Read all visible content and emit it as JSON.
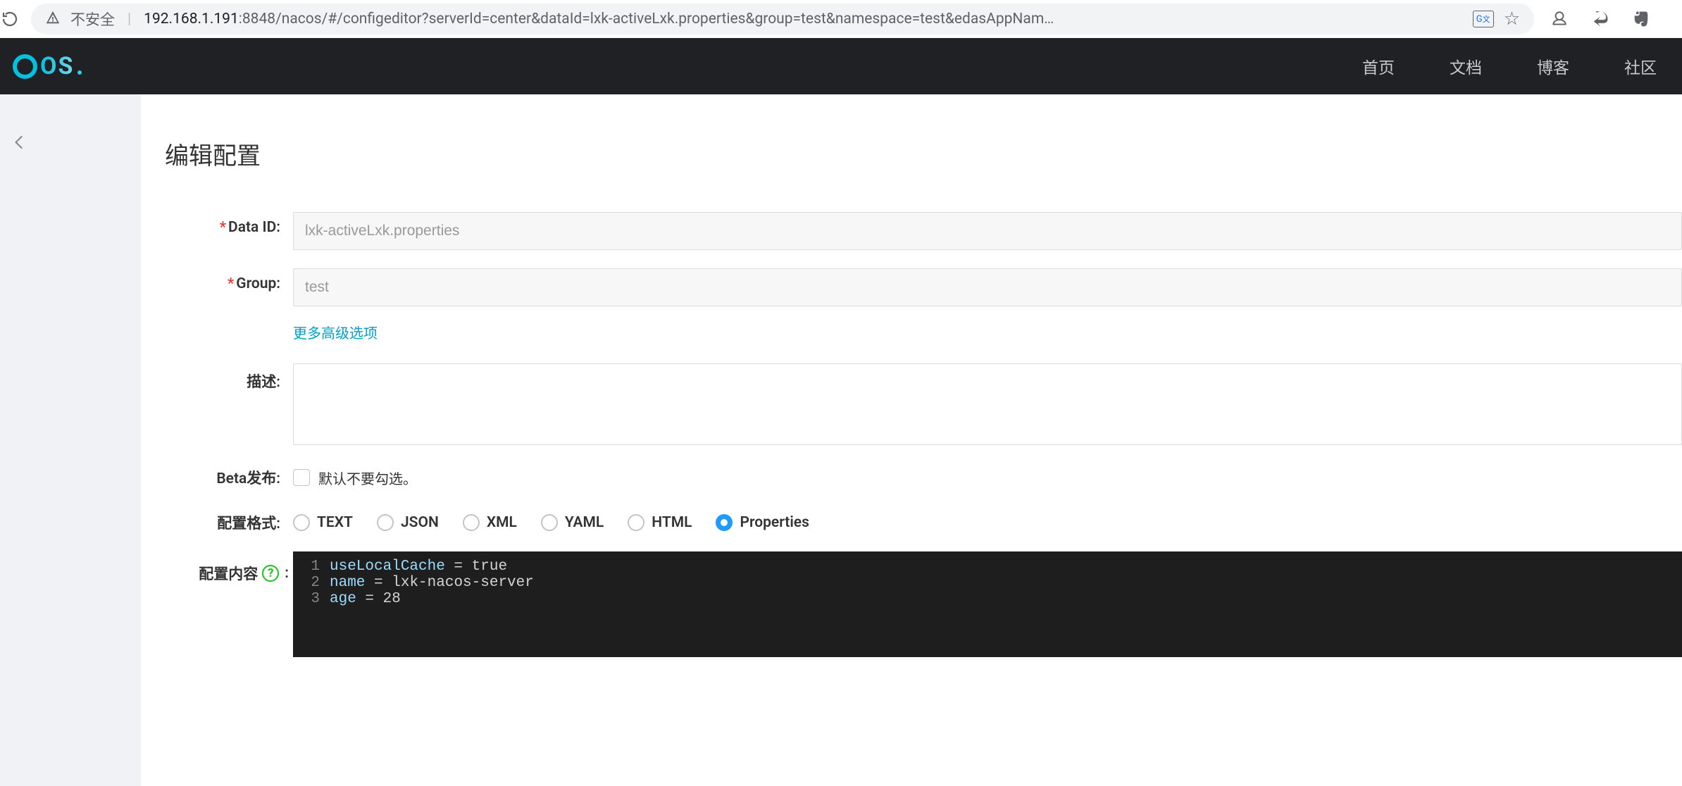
{
  "browser": {
    "insecure_label": "不安全",
    "url_host": "192.168.1.191",
    "url_port": ":8848",
    "url_path": "/nacos/#/configeditor?serverId=center&dataId=lxk-activeLxk.properties&group=test&namespace=test&edasAppNam…"
  },
  "header": {
    "logo_text": "OS",
    "nav": [
      "首页",
      "文档",
      "博客",
      "社区"
    ]
  },
  "page": {
    "title": "编辑配置",
    "labels": {
      "data_id": "Data ID:",
      "group": "Group:",
      "more": "更多高级选项",
      "desc": "描述:",
      "beta": "Beta发布:",
      "beta_tip": "默认不要勾选。",
      "format": "配置格式:",
      "content": "配置内容"
    },
    "fields": {
      "data_id": "lxk-activeLxk.properties",
      "group": "test",
      "desc": ""
    },
    "formats": [
      {
        "key": "TEXT",
        "label": "TEXT",
        "selected": false
      },
      {
        "key": "JSON",
        "label": "JSON",
        "selected": false
      },
      {
        "key": "XML",
        "label": "XML",
        "selected": false
      },
      {
        "key": "YAML",
        "label": "YAML",
        "selected": false
      },
      {
        "key": "HTML",
        "label": "HTML",
        "selected": false
      },
      {
        "key": "Properties",
        "label": "Properties",
        "selected": true
      }
    ],
    "code_lines": [
      {
        "n": "1",
        "key": "useLocalCache",
        "val": "true"
      },
      {
        "n": "2",
        "key": "name",
        "val": "lxk-nacos-server"
      },
      {
        "n": "3",
        "key": "age",
        "val": "28"
      }
    ]
  }
}
